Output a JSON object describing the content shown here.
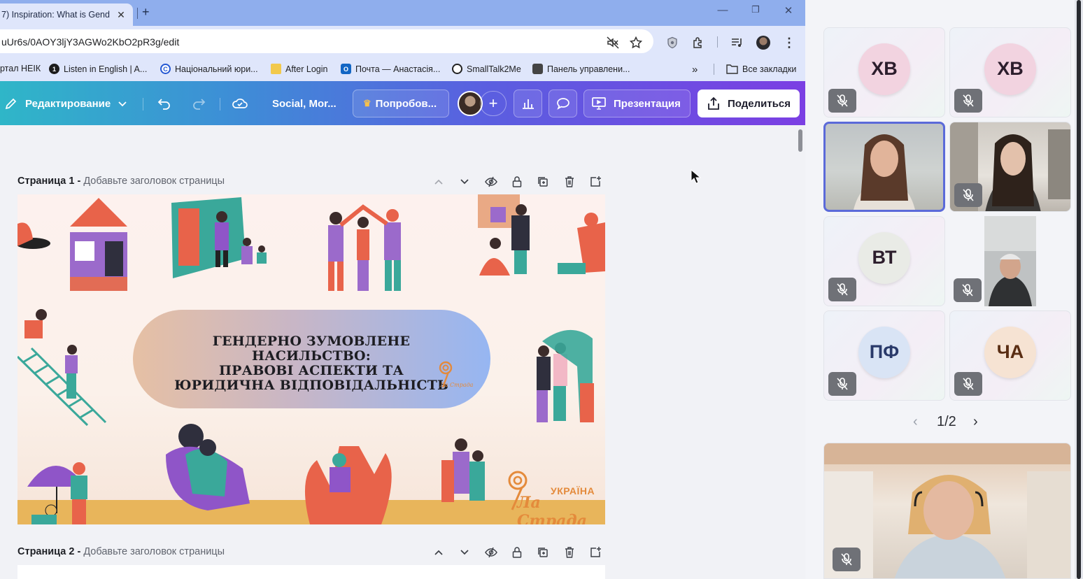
{
  "browser": {
    "tab_title": "7) Inspiration: What is Gend",
    "tab_close": "✕",
    "new_tab": "+",
    "url": "uUr6s/0AOY3ljY3AGWo2KbO2pR3g/edit",
    "win_min": "—",
    "win_max": "❐",
    "win_close": "✕",
    "bookmarks": [
      {
        "label": "ртал НЕІК"
      },
      {
        "label": "Listen in English | A..."
      },
      {
        "label": "Національний юри..."
      },
      {
        "label": "After Login"
      },
      {
        "label": "Почта — Анастасія..."
      },
      {
        "label": "SmallTalk2Me"
      },
      {
        "label": "Панель управлени..."
      }
    ],
    "bookmarks_more": "»",
    "all_bookmarks": "Все закладки"
  },
  "canva": {
    "edit_mode": "Редактирование",
    "doc_name": "Social, Mor...",
    "try_label": "Попробов...",
    "present_label": "Презентация",
    "share_label": "Поделиться"
  },
  "pages": [
    {
      "number": "Страница 1 -",
      "placeholder": "Добавьте заголовок страницы"
    },
    {
      "number": "Страница 2 -",
      "placeholder": "Добавьте заголовок страницы"
    }
  ],
  "slide": {
    "title_line1": "ГЕНДЕРНО ЗУМОВЛЕНЕ НАСИЛЬСТВО:",
    "title_line2": "ПРАВОВІ АСПЕКТИ ТА",
    "title_line3": "ЮРИДИЧНА ВІДПОВІДАЛЬНІСТЬ",
    "logo_small_text": "Ла Страда",
    "logo_country": "УКРАЇНА",
    "logo_name": "Ла Страда"
  },
  "meeting": {
    "participants": [
      {
        "initials": "ХВ",
        "color": "#f2d3e0"
      },
      {
        "initials": "ХВ",
        "color": "#f2d3e0"
      },
      {
        "initials": "",
        "video": true
      },
      {
        "initials": "",
        "video": true
      },
      {
        "initials": "ВТ",
        "color": "#e9ebe6"
      },
      {
        "initials": "",
        "video": true
      },
      {
        "initials": "ПФ",
        "color": "#d9e4f5"
      },
      {
        "initials": "ЧА",
        "color": "#f6e3d3"
      }
    ],
    "pager_prev": "‹",
    "pager_text": "1/2",
    "pager_next": "›"
  },
  "colors": {
    "accent": "#5b6ad9",
    "orange": "#e48a3b"
  }
}
